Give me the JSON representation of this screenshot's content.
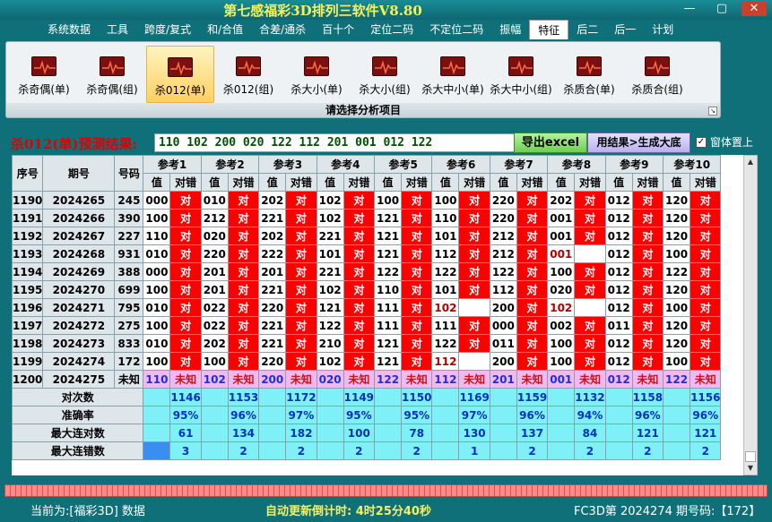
{
  "title": "第七感福彩3D排列三软件V8.80",
  "window": {
    "minimize": "—",
    "maximize": "▢",
    "close": "✕"
  },
  "menu": [
    "系统数据",
    "工具",
    "跨度/复式",
    "和/合值",
    "合差/通杀",
    "百十个",
    "定位二码",
    "不定位二码",
    "振幅",
    "特征",
    "后二",
    "后一",
    "计划"
  ],
  "menu_active": 9,
  "ribbon": {
    "items": [
      "杀奇偶(单)",
      "杀奇偶(组)",
      "杀012(单)",
      "杀012(组)",
      "杀大小(单)",
      "杀大小(组)",
      "杀大中小(单)",
      "杀大中小(组)",
      "杀质合(单)",
      "杀质合(组)"
    ],
    "selected": 2,
    "caption": "请选择分析项目",
    "corner": "↘"
  },
  "result": {
    "label": "杀012(单)预测结果:",
    "value": "110 102 200 020 122 112 201 001 012 122",
    "export_btn": "导出excel",
    "gen_btn": "用结果>生成大底",
    "ontop_label": "窗体置上",
    "ontop_checked": "✓"
  },
  "grid": {
    "h_serial": "序号",
    "h_period": "期号",
    "h_number": "号码",
    "refs": [
      "参考1",
      "参考2",
      "参考3",
      "参考4",
      "参考5",
      "参考6",
      "参考7",
      "参考8",
      "参考9",
      "参考10"
    ],
    "sub_value": "值",
    "sub_check": "对错",
    "right_mark": "对",
    "rows": [
      {
        "s": "1190",
        "p": "2024265",
        "n": "245",
        "v": [
          "000",
          "010",
          "202",
          "102",
          "100",
          "100",
          "220",
          "202",
          "012",
          "120"
        ],
        "r": [
          1,
          1,
          1,
          1,
          1,
          1,
          1,
          1,
          1,
          1
        ]
      },
      {
        "s": "1191",
        "p": "2024266",
        "n": "390",
        "v": [
          "100",
          "212",
          "221",
          "102",
          "121",
          "110",
          "220",
          "001",
          "012",
          "120"
        ],
        "r": [
          1,
          1,
          1,
          1,
          1,
          1,
          1,
          1,
          1,
          1
        ]
      },
      {
        "s": "1192",
        "p": "2024267",
        "n": "227",
        "v": [
          "110",
          "020",
          "202",
          "221",
          "121",
          "101",
          "212",
          "001",
          "012",
          "120"
        ],
        "r": [
          1,
          1,
          1,
          1,
          1,
          1,
          1,
          1,
          1,
          1
        ]
      },
      {
        "s": "1193",
        "p": "2024268",
        "n": "931",
        "v": [
          "010",
          "220",
          "222",
          "101",
          "121",
          "112",
          "212",
          "001",
          "012",
          "100"
        ],
        "r": [
          1,
          1,
          1,
          1,
          1,
          1,
          1,
          0,
          1,
          1
        ],
        "red": [
          7
        ]
      },
      {
        "s": "1194",
        "p": "2024269",
        "n": "388",
        "v": [
          "000",
          "201",
          "201",
          "221",
          "122",
          "122",
          "122",
          "100",
          "012",
          "122"
        ],
        "r": [
          1,
          1,
          1,
          1,
          1,
          1,
          1,
          1,
          1,
          1
        ]
      },
      {
        "s": "1195",
        "p": "2024270",
        "n": "699",
        "v": [
          "100",
          "201",
          "221",
          "102",
          "110",
          "101",
          "112",
          "020",
          "012",
          "120"
        ],
        "r": [
          1,
          1,
          1,
          1,
          1,
          1,
          1,
          1,
          1,
          1
        ]
      },
      {
        "s": "1196",
        "p": "2024271",
        "n": "795",
        "v": [
          "010",
          "022",
          "220",
          "121",
          "111",
          "102",
          "200",
          "102",
          "012",
          "100"
        ],
        "r": [
          1,
          1,
          1,
          1,
          1,
          0,
          1,
          0,
          1,
          1
        ],
        "red": [
          5,
          7
        ]
      },
      {
        "s": "1197",
        "p": "2024272",
        "n": "275",
        "v": [
          "100",
          "022",
          "221",
          "122",
          "111",
          "111",
          "000",
          "002",
          "011",
          "120"
        ],
        "r": [
          1,
          1,
          1,
          1,
          1,
          1,
          1,
          1,
          1,
          1
        ]
      },
      {
        "s": "1198",
        "p": "2024273",
        "n": "833",
        "v": [
          "010",
          "202",
          "221",
          "210",
          "121",
          "122",
          "011",
          "100",
          "012",
          "120"
        ],
        "r": [
          1,
          1,
          1,
          1,
          1,
          1,
          1,
          1,
          1,
          1
        ]
      },
      {
        "s": "1199",
        "p": "2024274",
        "n": "172",
        "v": [
          "100",
          "100",
          "220",
          "102",
          "121",
          "112",
          "200",
          "100",
          "012",
          "100"
        ],
        "r": [
          1,
          1,
          1,
          1,
          1,
          0,
          1,
          1,
          1,
          1
        ],
        "red": [
          5
        ]
      }
    ],
    "pred": {
      "s": "1200",
      "p": "2024275",
      "n": "未知",
      "v": [
        "110",
        "102",
        "200",
        "020",
        "122",
        "112",
        "201",
        "001",
        "012",
        "122"
      ],
      "unknown": "未知"
    },
    "stats": [
      {
        "label": "对次数",
        "vals": [
          "1146",
          "1153",
          "1172",
          "1149",
          "1150",
          "1169",
          "1159",
          "1132",
          "1158",
          "1156"
        ]
      },
      {
        "label": "准确率",
        "vals": [
          "95%",
          "96%",
          "97%",
          "95%",
          "95%",
          "97%",
          "96%",
          "94%",
          "96%",
          "96%"
        ]
      },
      {
        "label": "最大连对数",
        "vals": [
          "61",
          "134",
          "182",
          "100",
          "78",
          "130",
          "137",
          "84",
          "121",
          "121"
        ]
      },
      {
        "label": "最大连错数",
        "vals": [
          "3",
          "2",
          "2",
          "2",
          "2",
          "1",
          "2",
          "2",
          "2",
          "2"
        ]
      }
    ]
  },
  "scroll": {
    "up": "▲",
    "down": "▼"
  },
  "status": {
    "current": "当前为:[福彩3D] 数据",
    "countdown": "自动更新倒计时: 4时25分40秒",
    "issue": "FC3D第 2024274 期号码:【172】"
  }
}
